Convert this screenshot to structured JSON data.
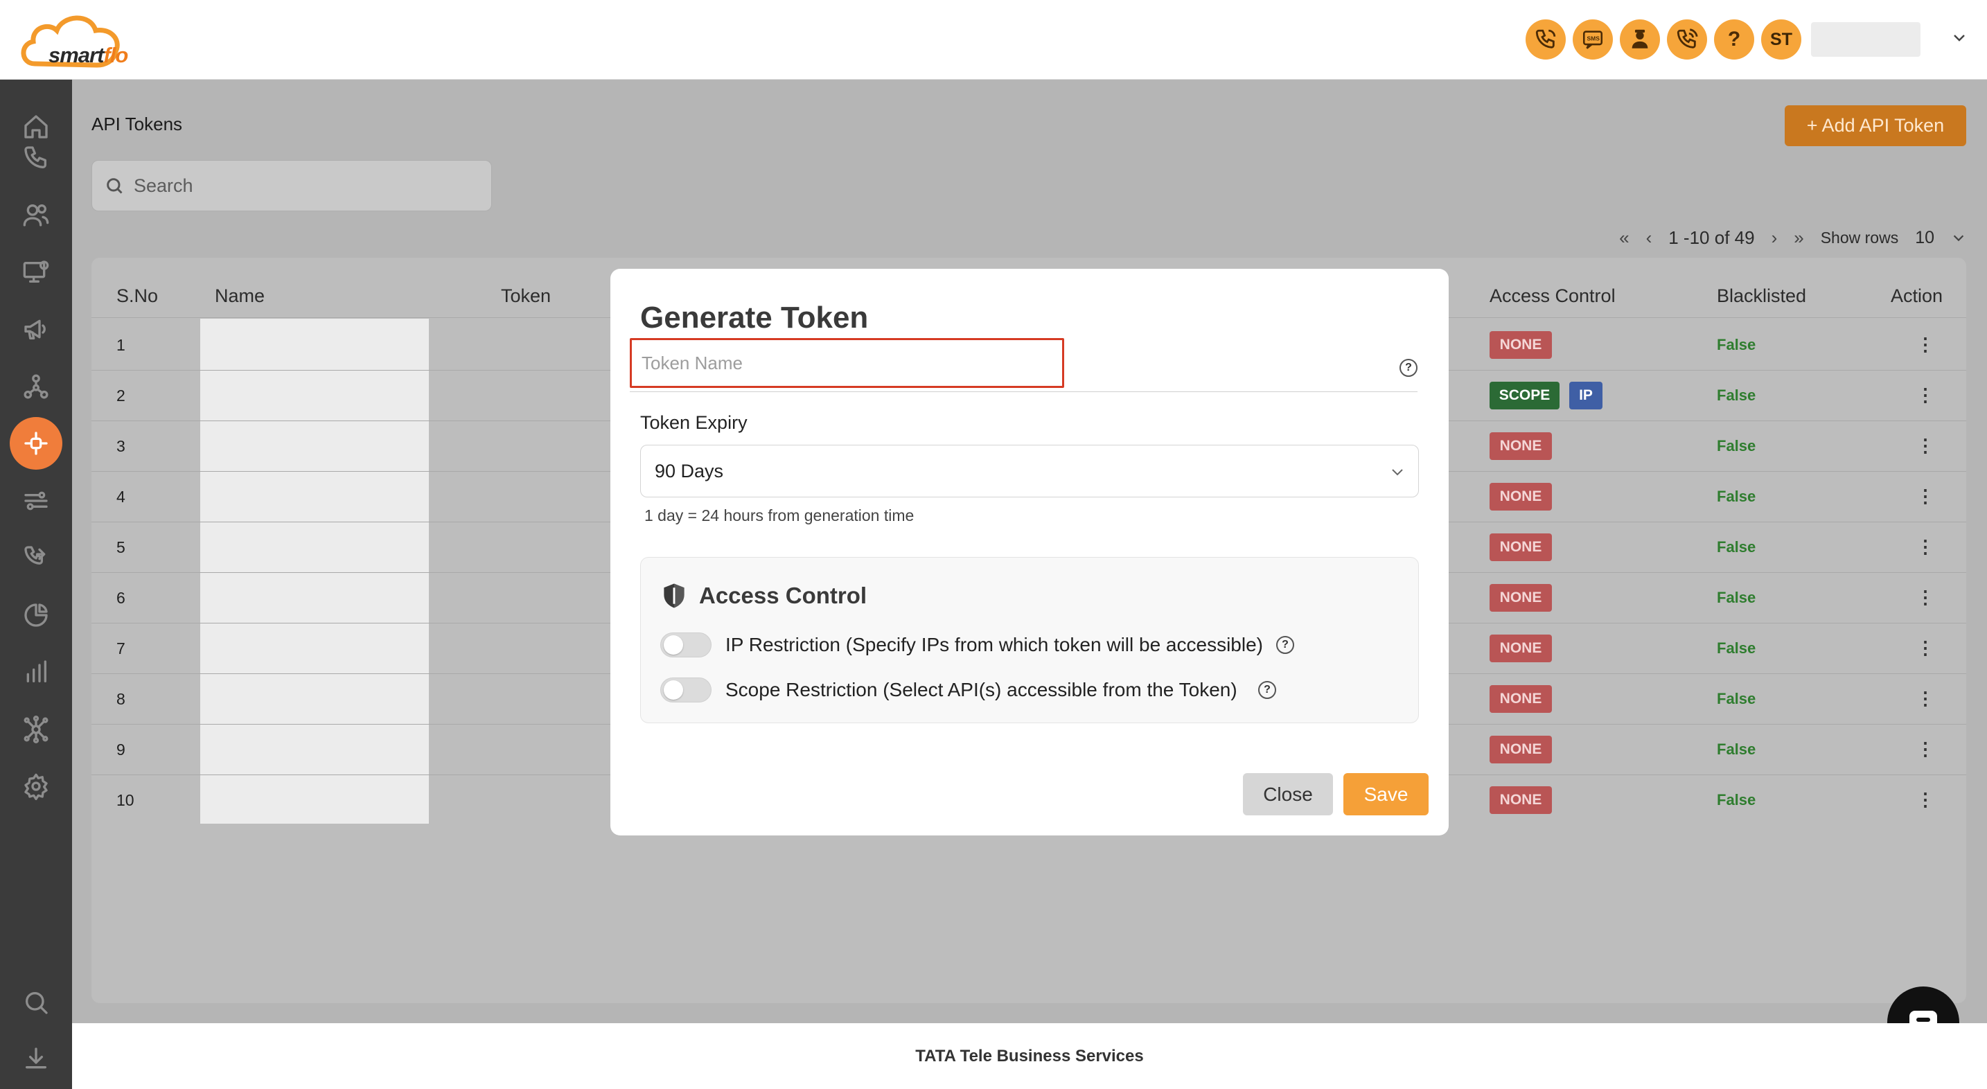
{
  "brand": {
    "logo_text_a": "smart",
    "logo_text_b": "flo",
    "accent": "#f07d1b"
  },
  "header": {
    "icons": [
      "phone-icon",
      "sms-icon",
      "agent-icon",
      "phone-call-icon",
      "help-icon"
    ],
    "help_glyph": "?",
    "avatar_initials": "ST"
  },
  "sidebar": {
    "items": [
      "home-icon",
      "phone-icon",
      "users-icon",
      "monitor-settings-icon",
      "megaphone-icon",
      "network-icon",
      "api-plug-icon",
      "routing-icon",
      "call-flow-icon",
      "pie-chart-icon",
      "bar-chart-icon",
      "integrations-icon",
      "settings-icon",
      "search-icon",
      "download-icon"
    ],
    "active": "api-plug-icon"
  },
  "page": {
    "title": "API Tokens",
    "add_button": "+ Add API Token",
    "search_placeholder": "Search"
  },
  "pagination": {
    "first": "«",
    "prev": "‹",
    "range": "1 -10 of 49",
    "next": "›",
    "last": "»",
    "rows_label": "Show rows",
    "rows_value": "10"
  },
  "table": {
    "columns": {
      "sno": "S.No",
      "name": "Name",
      "token": "Token",
      "access": "Access Control",
      "blacklisted": "Blacklisted",
      "action": "Action"
    },
    "rows": [
      {
        "sno": "1",
        "access": [
          "NONE"
        ],
        "blacklisted": "False"
      },
      {
        "sno": "2",
        "access": [
          "SCOPE",
          "IP"
        ],
        "blacklisted": "False"
      },
      {
        "sno": "3",
        "access": [
          "NONE"
        ],
        "blacklisted": "False"
      },
      {
        "sno": "4",
        "access": [
          "NONE"
        ],
        "blacklisted": "False"
      },
      {
        "sno": "5",
        "access": [
          "NONE"
        ],
        "blacklisted": "False"
      },
      {
        "sno": "6",
        "access": [
          "NONE"
        ],
        "blacklisted": "False"
      },
      {
        "sno": "7",
        "access": [
          "NONE"
        ],
        "blacklisted": "False"
      },
      {
        "sno": "8",
        "access": [
          "NONE"
        ],
        "blacklisted": "False"
      },
      {
        "sno": "9",
        "access": [
          "NONE"
        ],
        "blacklisted": "False"
      },
      {
        "sno": "10",
        "access": [
          "NONE"
        ],
        "blacklisted": "False"
      }
    ],
    "action_glyph": "⋮"
  },
  "modal": {
    "title": "Generate Token",
    "token_name_placeholder": "Token Name",
    "help_glyph": "?",
    "expiry_label": "Token Expiry",
    "expiry_value": "90 Days",
    "expiry_hint": "1 day = 24 hours from generation time",
    "access_title": "Access Control",
    "ip_restriction": "IP Restriction (Specify IPs from which token will be accessible)",
    "scope_restriction": "Scope Restriction (Select API(s) accessible from the Token)",
    "ip_enabled": false,
    "scope_enabled": false,
    "close_label": "Close",
    "save_label": "Save"
  },
  "footer": {
    "text": "TATA Tele Business Services"
  }
}
